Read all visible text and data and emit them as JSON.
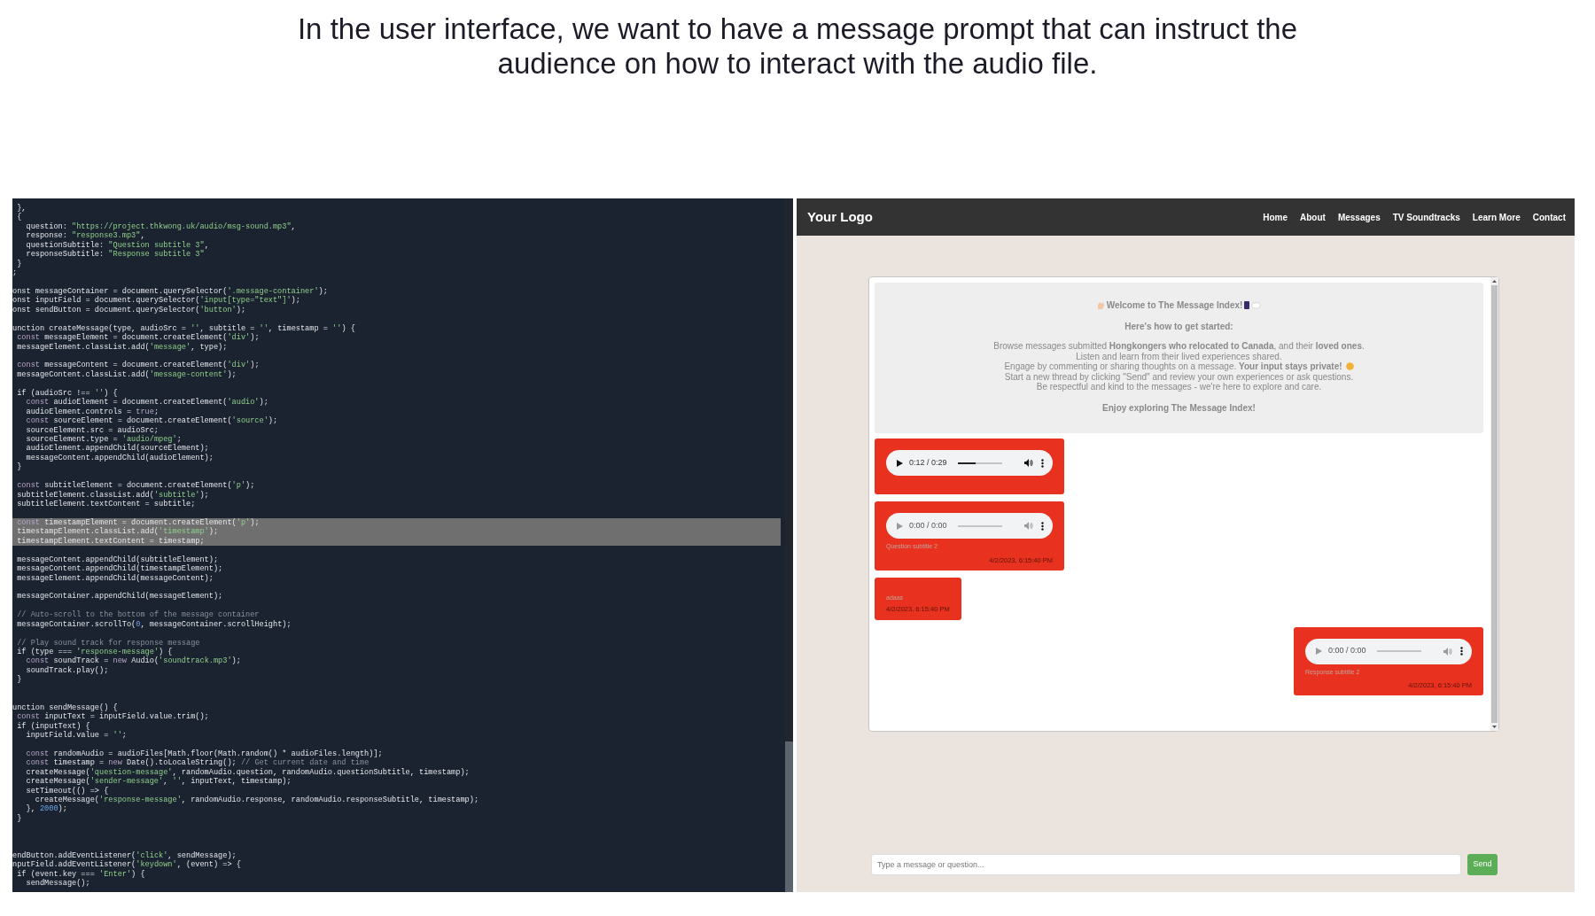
{
  "slide_title": "In the user interface, we want to have a message prompt that can instruct the audience on how to interact with the audio file.",
  "code_editor": {
    "lines": [
      {
        "kind": "code",
        "text": " },",
        "highlighted": false
      },
      {
        "kind": "code",
        "text": " {",
        "highlighted": false
      },
      {
        "kind": "code",
        "text": "   question: \"https://project.thkwong.uk/audio/msg-sound.mp3\",",
        "highlighted": false
      },
      {
        "kind": "code",
        "text": "   response: \"response3.mp3\",",
        "highlighted": false
      },
      {
        "kind": "code",
        "text": "   questionSubtitle: \"Question subtitle 3\",",
        "highlighted": false
      },
      {
        "kind": "code",
        "text": "   responseSubtitle: \"Response subtitle 3\"",
        "highlighted": false
      },
      {
        "kind": "code",
        "text": " }",
        "highlighted": false
      },
      {
        "kind": "code",
        "text": ";",
        "highlighted": false
      },
      {
        "kind": "blank"
      },
      {
        "kind": "code",
        "text": "onst messageContainer = document.querySelector('.message-container');",
        "highlighted": false
      },
      {
        "kind": "code",
        "text": "onst inputField = document.querySelector('input[type=\"text\"]');",
        "highlighted": false
      },
      {
        "kind": "code",
        "text": "onst sendButton = document.querySelector('button');",
        "highlighted": false
      },
      {
        "kind": "blank"
      },
      {
        "kind": "code",
        "text": "unction createMessage(type, audioSrc = '', subtitle = '', timestamp = '') {",
        "highlighted": false
      },
      {
        "kind": "code",
        "text": " const messageElement = document.createElement('div');",
        "highlighted": false
      },
      {
        "kind": "code",
        "text": " messageElement.classList.add('message', type);",
        "highlighted": false
      },
      {
        "kind": "blank"
      },
      {
        "kind": "code",
        "text": " const messageContent = document.createElement('div');",
        "highlighted": false
      },
      {
        "kind": "code",
        "text": " messageContent.classList.add('message-content');",
        "highlighted": false
      },
      {
        "kind": "blank"
      },
      {
        "kind": "code",
        "text": " if (audioSrc !== '') {",
        "highlighted": false
      },
      {
        "kind": "code",
        "text": "   const audioElement = document.createElement('audio');",
        "highlighted": false
      },
      {
        "kind": "code",
        "text": "   audioElement.controls = true;",
        "highlighted": false
      },
      {
        "kind": "code",
        "text": "   const sourceElement = document.createElement('source');",
        "highlighted": false
      },
      {
        "kind": "code",
        "text": "   sourceElement.src = audioSrc;",
        "highlighted": false
      },
      {
        "kind": "code",
        "text": "   sourceElement.type = 'audio/mpeg';",
        "highlighted": false
      },
      {
        "kind": "code",
        "text": "   audioElement.appendChild(sourceElement);",
        "highlighted": false
      },
      {
        "kind": "code",
        "text": "   messageContent.appendChild(audioElement);",
        "highlighted": false
      },
      {
        "kind": "code",
        "text": " }",
        "highlighted": false
      },
      {
        "kind": "blank"
      },
      {
        "kind": "code",
        "text": " const subtitleElement = document.createElement('p');",
        "highlighted": false
      },
      {
        "kind": "code",
        "text": " subtitleElement.classList.add('subtitle');",
        "highlighted": false
      },
      {
        "kind": "code",
        "text": " subtitleElement.textContent = subtitle;",
        "highlighted": false
      },
      {
        "kind": "blank"
      },
      {
        "kind": "code",
        "text": " const timestampElement = document.createElement('p');",
        "highlighted": true
      },
      {
        "kind": "code",
        "text": " timestampElement.classList.add('timestamp');",
        "highlighted": true
      },
      {
        "kind": "code",
        "text": " timestampElement.textContent = timestamp;",
        "highlighted": true
      },
      {
        "kind": "blank"
      },
      {
        "kind": "code",
        "text": " messageContent.appendChild(subtitleElement);",
        "highlighted": false
      },
      {
        "kind": "code",
        "text": " messageContent.appendChild(timestampElement);",
        "highlighted": false
      },
      {
        "kind": "code",
        "text": " messageElement.appendChild(messageContent);",
        "highlighted": false
      },
      {
        "kind": "blank"
      },
      {
        "kind": "code",
        "text": " messageContainer.appendChild(messageElement);",
        "highlighted": false
      },
      {
        "kind": "blank"
      },
      {
        "kind": "code",
        "text": " // Auto-scroll to the bottom of the message container",
        "highlighted": false
      },
      {
        "kind": "code",
        "text": " messageContainer.scrollTo(0, messageContainer.scrollHeight);",
        "highlighted": false
      },
      {
        "kind": "blank"
      },
      {
        "kind": "code",
        "text": " // Play sound track for response message",
        "highlighted": false
      },
      {
        "kind": "code",
        "text": " if (type === 'response-message') {",
        "highlighted": false
      },
      {
        "kind": "code",
        "text": "   const soundTrack = new Audio('soundtrack.mp3');",
        "highlighted": false
      },
      {
        "kind": "code",
        "text": "   soundTrack.play();",
        "highlighted": false
      },
      {
        "kind": "code",
        "text": " }",
        "highlighted": false
      },
      {
        "kind": "blank"
      },
      {
        "kind": "blank"
      },
      {
        "kind": "code",
        "text": "unction sendMessage() {",
        "highlighted": false
      },
      {
        "kind": "code",
        "text": " const inputText = inputField.value.trim();",
        "highlighted": false
      },
      {
        "kind": "code",
        "text": " if (inputText) {",
        "highlighted": false
      },
      {
        "kind": "code",
        "text": "   inputField.value = '';",
        "highlighted": false
      },
      {
        "kind": "blank"
      },
      {
        "kind": "code",
        "text": "   const randomAudio = audioFiles[Math.floor(Math.random() * audioFiles.length)];",
        "highlighted": false
      },
      {
        "kind": "code",
        "text": "   const timestamp = new Date().toLocaleString(); // Get current date and time",
        "highlighted": false
      },
      {
        "kind": "code",
        "text": "   createMessage('question-message', randomAudio.question, randomAudio.questionSubtitle, timestamp);",
        "highlighted": false
      },
      {
        "kind": "code",
        "text": "   createMessage('sender-message', '', inputText, timestamp);",
        "highlighted": false
      },
      {
        "kind": "code",
        "text": "   setTimeout(() => {",
        "highlighted": false
      },
      {
        "kind": "code",
        "text": "     createMessage('response-message', randomAudio.response, randomAudio.responseSubtitle, timestamp);",
        "highlighted": false
      },
      {
        "kind": "code",
        "text": "   }, 2000);",
        "highlighted": false
      },
      {
        "kind": "code",
        "text": " }",
        "highlighted": false
      },
      {
        "kind": "blank"
      },
      {
        "kind": "blank"
      },
      {
        "kind": "blank"
      },
      {
        "kind": "code",
        "text": "endButton.addEventListener('click', sendMessage);",
        "highlighted": false
      },
      {
        "kind": "code",
        "text": "nputField.addEventListener('keydown', (event) => {",
        "highlighted": false
      },
      {
        "kind": "code",
        "text": " if (event.key === 'Enter') {",
        "highlighted": false
      },
      {
        "kind": "code",
        "text": "   sendMessage();",
        "highlighted": false
      }
    ]
  },
  "web_page": {
    "navbar": {
      "logo": "Your Logo",
      "links": [
        "Home",
        "About",
        "Messages",
        "TV Soundtracks",
        "Learn More",
        "Contact"
      ]
    },
    "welcome": {
      "title": "Welcome to The Message Index!",
      "subtitle": "Here's how to get started:",
      "lines": [
        {
          "text": "Browse messages submitted **Hongkongers who relocated to Canada**, and their **loved ones**.",
          "emoji": false
        },
        {
          "text": "Listen and learn from their lived experiences shared.",
          "emoji": false
        },
        {
          "text": "Engage by commenting or sharing thoughts on a message. **Your input stays private!**",
          "emoji": true
        },
        {
          "text": "Start a new thread by clicking \"Send\" and review your own experiences or ask questions.",
          "emoji": false
        },
        {
          "text": "Be respectful and kind to the messages - we're here to explore and care.",
          "emoji": false
        }
      ],
      "closing": "Enjoy exploring The Message Index!"
    },
    "messages": [
      {
        "kind": "question",
        "player": {
          "time": "0:12 / 0:29",
          "level": 0.4,
          "disabled": false
        }
      },
      {
        "kind": "question",
        "player": {
          "time": "0:00 / 0:00",
          "disabled": true
        },
        "subtitle": "Question subtitle 2",
        "timestamp": "4/2/2023, 6:15:40 PM"
      },
      {
        "kind": "sender",
        "subtitle": "adaas",
        "timestamp": "4/2/2023, 6:15:40 PM"
      },
      {
        "kind": "response",
        "player": {
          "time": "0:00 / 0:00",
          "disabled": true
        },
        "subtitle": "Response subtitle 2",
        "timestamp": "4/2/2023, 6:15:40 PM"
      }
    ],
    "input": {
      "placeholder": "Type a message or question..."
    },
    "send_button": "Send"
  }
}
